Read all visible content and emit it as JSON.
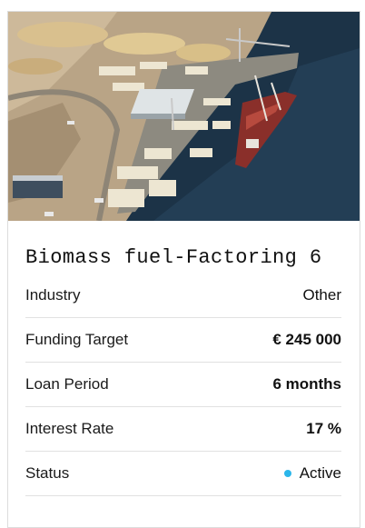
{
  "listing": {
    "title": "Biomass fuel-Factoring 6",
    "image_alt": "aerial view of timber port",
    "details": [
      {
        "label": "Industry",
        "value": "Other",
        "bold": false
      },
      {
        "label": "Funding Target",
        "value": "€ 245 000",
        "bold": true
      },
      {
        "label": "Loan Period",
        "value": "6 months",
        "bold": true
      },
      {
        "label": "Interest Rate",
        "value": "17 %",
        "bold": true
      },
      {
        "label": "Status",
        "value": "Active",
        "bold": false
      }
    ],
    "status_color": "#2bb6ea"
  }
}
